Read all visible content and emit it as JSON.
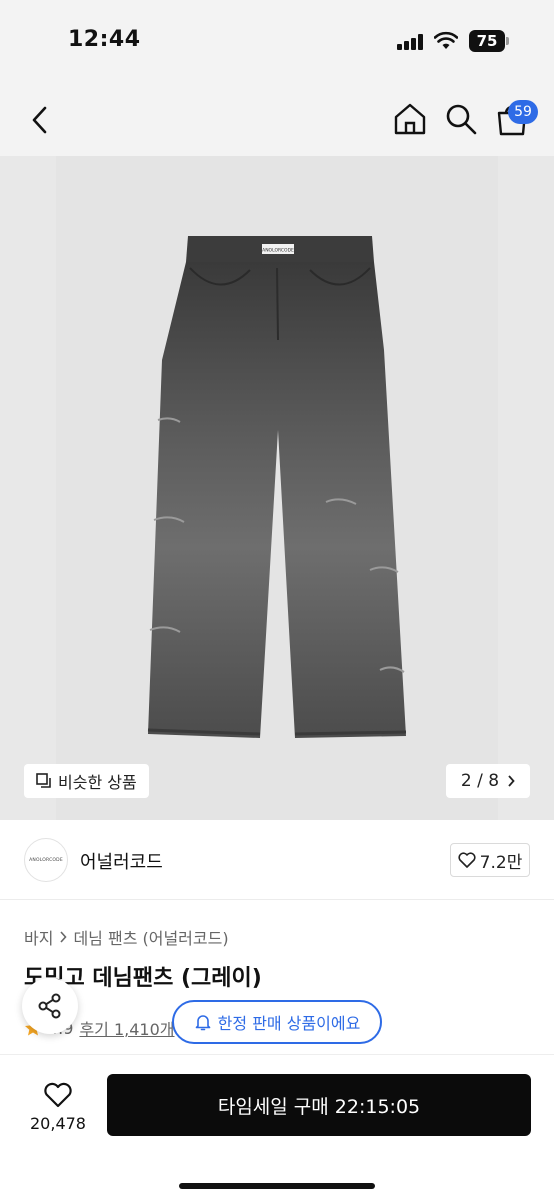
{
  "status_bar": {
    "time": "12:44",
    "battery": "75"
  },
  "header": {
    "cart_count": "59",
    "icons": [
      "back-arrow-icon",
      "home-icon",
      "search-icon",
      "cart-icon"
    ]
  },
  "gallery": {
    "similar_label": "비슷한 상품",
    "page_indicator": "2 / 8",
    "image_label": "ANOLORCODE"
  },
  "brand": {
    "logo_text": "ANOLORCODE",
    "name": "어널러코드",
    "likes": "7.2만"
  },
  "product": {
    "breadcrumb": [
      "바지",
      "데님 팬츠 (어널러코드)"
    ],
    "title": "도밍고 데님팬츠 (그레이)",
    "rating": "4.9",
    "reviews": "후기 1,410개"
  },
  "toast": {
    "text": "한정 판매 상품이에요"
  },
  "bottom_bar": {
    "wish_count": "20,478",
    "buy_label": "타임세일 구매 22:15:05"
  },
  "colors": {
    "accent": "#2e6be6",
    "buy_button": "#0b0b0b",
    "star": "#f5a623"
  }
}
